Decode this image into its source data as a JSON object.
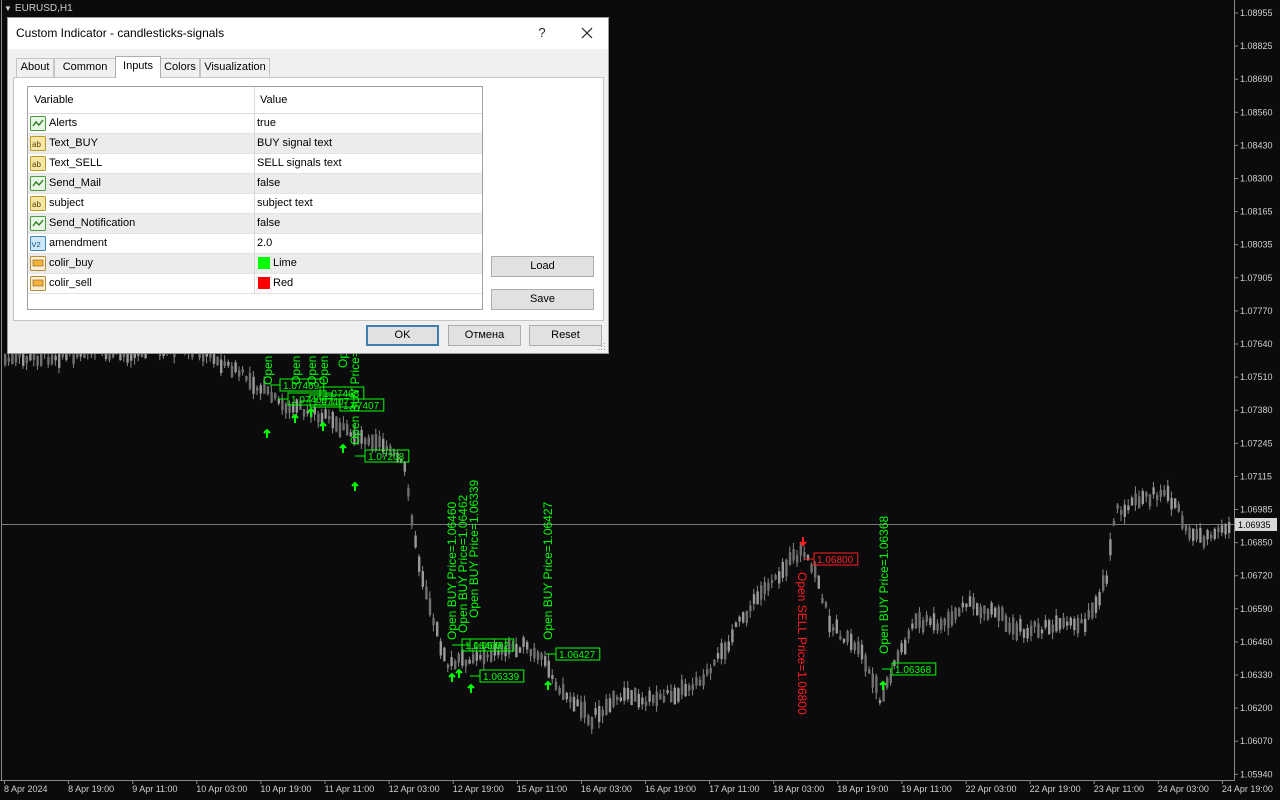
{
  "chart": {
    "title": "EURUSD,H1",
    "current_price": "1.06935",
    "price_axis": [
      "1.08955",
      "1.08825",
      "1.08690",
      "1.08560",
      "1.08430",
      "1.08300",
      "1.08165",
      "1.08035",
      "1.07905",
      "1.07770",
      "1.07640",
      "1.07510",
      "1.07380",
      "1.07245",
      "1.07115",
      "1.06985",
      "1.06850",
      "1.06720",
      "1.06590",
      "1.06460",
      "1.06330",
      "1.06200",
      "1.06070",
      "1.05940"
    ],
    "time_axis": [
      "8 Apr 2024",
      "8 Apr 19:00",
      "9 Apr 11:00",
      "10 Apr 03:00",
      "10 Apr 19:00",
      "11 Apr 11:00",
      "12 Apr 03:00",
      "12 Apr 19:00",
      "15 Apr 11:00",
      "16 Apr 03:00",
      "16 Apr 19:00",
      "17 Apr 11:00",
      "18 Apr 03:00",
      "18 Apr 19:00",
      "19 Apr 11:00",
      "22 Apr 03:00",
      "22 Apr 19:00",
      "23 Apr 11:00",
      "24 Apr 03:00",
      "24 Apr 19:00"
    ],
    "colors": {
      "background": "#0b0b0e",
      "candle": "#8a8a8a",
      "buy": "#00ff00",
      "sell": "#ff2020"
    },
    "buy_signals": [
      {
        "label": "1.06427",
        "vertical_text": "Open BUY Price=1.06427"
      },
      {
        "label": "1.06339",
        "vertical_text": "Open BUY Price=1.06339"
      },
      {
        "label": "1.06368",
        "vertical_text": "Open BUY Price=1.06368"
      },
      {
        "label": "1.07208",
        "vertical_text": "Open BUY Price="
      },
      {
        "label": "1.06460",
        "vertical_text": "Open BUY Price=1.06460"
      },
      {
        "label": "1.06462",
        "vertical_text": "Open BUY Price=1.06462"
      },
      {
        "label": "1.07469",
        "vertical_text": "Open"
      },
      {
        "label": "1.07407",
        "vertical_text": "Open"
      },
      {
        "label": "1.07468",
        "vertical_text": "Open"
      }
    ],
    "sell_signals": [
      {
        "label": "1.06800",
        "vertical_text": "Open SELL Price=1.06800"
      }
    ]
  },
  "dialog": {
    "title": "Custom Indicator - candlesticks-signals",
    "help_label": "?",
    "tabs": [
      {
        "label": "About"
      },
      {
        "label": "Common"
      },
      {
        "label": "Inputs"
      },
      {
        "label": "Colors"
      },
      {
        "label": "Visualization"
      }
    ],
    "active_tab": "Inputs",
    "grid": {
      "col_variable": "Variable",
      "col_value": "Value",
      "rows": [
        {
          "icon": "bool-icon",
          "name": "Alerts",
          "value": "true"
        },
        {
          "icon": "string-icon",
          "name": "Text_BUY",
          "value": "BUY signal text"
        },
        {
          "icon": "string-icon",
          "name": "Text_SELL",
          "value": "SELL signals text"
        },
        {
          "icon": "bool-icon",
          "name": "Send_Mail",
          "value": "false"
        },
        {
          "icon": "string-icon",
          "name": "subject",
          "value": "subject text"
        },
        {
          "icon": "bool-icon",
          "name": "Send_Notification",
          "value": "false"
        },
        {
          "icon": "double-icon",
          "name": "amendment",
          "value": "2.0"
        },
        {
          "icon": "color-icon",
          "name": "colir_buy",
          "value": "Lime",
          "swatch": "#00ff00"
        },
        {
          "icon": "color-icon",
          "name": "colir_sell",
          "value": "Red",
          "swatch": "#ff0000"
        }
      ]
    },
    "load_label": "Load",
    "save_label": "Save",
    "ok_label": "OK",
    "cancel_label": "Отмена",
    "reset_label": "Reset"
  }
}
